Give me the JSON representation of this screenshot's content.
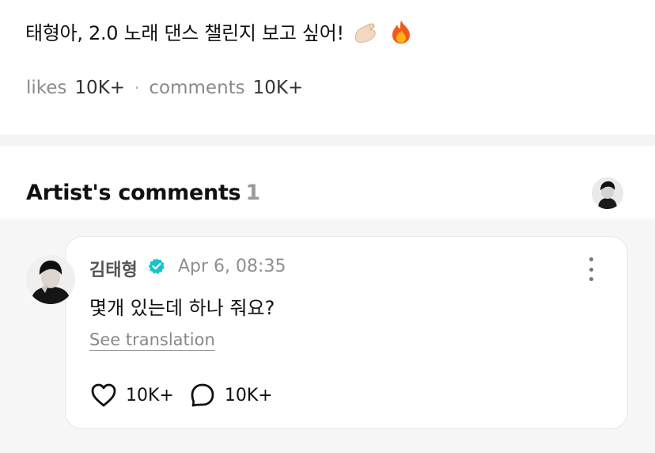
{
  "post": {
    "text": "태형아, 2.0 노래 댄스 챌린지 보고 싶어!",
    "emojis": [
      "pinching-hand-icon",
      "fire-icon"
    ],
    "likes_label": "likes",
    "likes_count": "10K+",
    "separator": "·",
    "comments_label": "comments",
    "comments_count": "10K+"
  },
  "artist_comments": {
    "heading": "Artist's comments",
    "count": "1",
    "comment": {
      "author": "김태형",
      "verified": true,
      "timestamp": "Apr 6, 08:35",
      "body": "몇개 있는데 하나 줘요?",
      "translate_link": "See translation",
      "like_count": "10K+",
      "reply_count": "10K+"
    }
  },
  "colors": {
    "verified_badge": "#17c3c9",
    "muted_text": "#8a8a8a",
    "divider": "#f4f4f4",
    "comment_area_bg": "#f7f7f7"
  }
}
